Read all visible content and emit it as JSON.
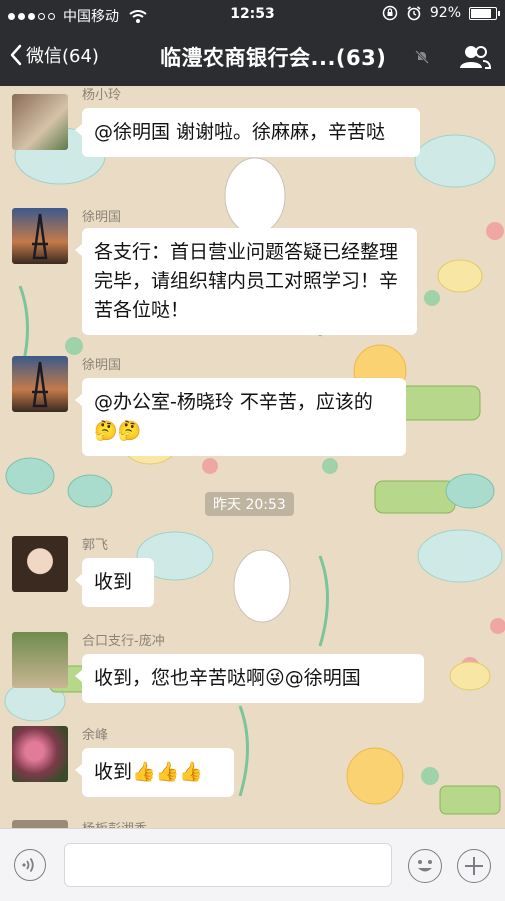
{
  "status_bar": {
    "carrier": "中国移动",
    "time": "12:53",
    "battery": "92%",
    "battery_level": 0.92,
    "signal_bars": 3
  },
  "nav": {
    "back_label": "微信(64)",
    "title": "临澧农商银行会...(63)"
  },
  "messages": [
    {
      "sender": "杨小玲",
      "text": "@徐明国 谢谢啦。徐麻麻，辛苦哒"
    },
    {
      "sender": "徐明国",
      "text": "各支行：首日营业问题答疑已经整理完毕，请组织辖内员工对照学习！辛苦各位哒！"
    },
    {
      "sender": "徐明国",
      "text": "@办公室-杨晓玲 不辛苦，应该的🤔🤔"
    },
    {
      "sender": "郭飞",
      "text": "收到"
    },
    {
      "sender": "合口支行-庞冲",
      "text": "收到，您也辛苦哒啊😜@徐明国"
    },
    {
      "sender": "余峰",
      "text": "收到👍👍👍"
    },
    {
      "sender": "杨板彭湘香",
      "text": ""
    }
  ],
  "timestamp": "昨天 20:53",
  "colors": {
    "nav_bg": "#2b2d31",
    "chat_bg": "#eadcc4",
    "bubble": "#ffffff",
    "input_bar": "#f4f4f6"
  },
  "icons": {
    "back": "chevron-left-icon",
    "mute": "mute-bell-icon",
    "group": "group-people-icon",
    "voice": "voice-icon",
    "emoji": "emoji-icon",
    "plus": "plus-icon"
  }
}
